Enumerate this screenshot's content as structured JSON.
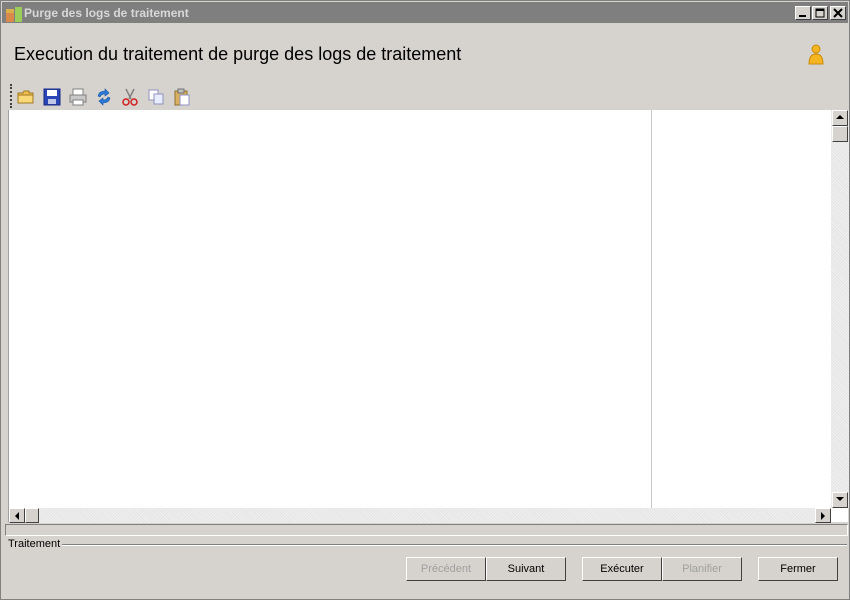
{
  "window": {
    "title": "Purge des logs de traitement",
    "controls": {
      "minimize": "minimize-icon",
      "maximize": "maximize-icon",
      "close": "close-icon"
    }
  },
  "header": {
    "title": "Execution du traitement de purge des logs de traitement",
    "user_icon": "user-icon"
  },
  "toolbar": {
    "items": [
      {
        "icon": "open-folder-icon"
      },
      {
        "icon": "save-icon"
      },
      {
        "icon": "print-icon"
      },
      {
        "icon": "refresh-icon"
      },
      {
        "icon": "cut-icon"
      },
      {
        "icon": "copy-icon"
      },
      {
        "icon": "paste-icon"
      }
    ]
  },
  "group": {
    "label": "Traitement"
  },
  "buttons": {
    "previous": "Précédent",
    "next": "Suivant",
    "execute": "Exécuter",
    "schedule": "Planifier",
    "close": "Fermer"
  },
  "colors": {
    "window_bg": "#d6d3ce",
    "titlebar_bg": "#7f7f7f",
    "content_bg": "#ffffff",
    "disabled_text": "#a0a0a0"
  }
}
